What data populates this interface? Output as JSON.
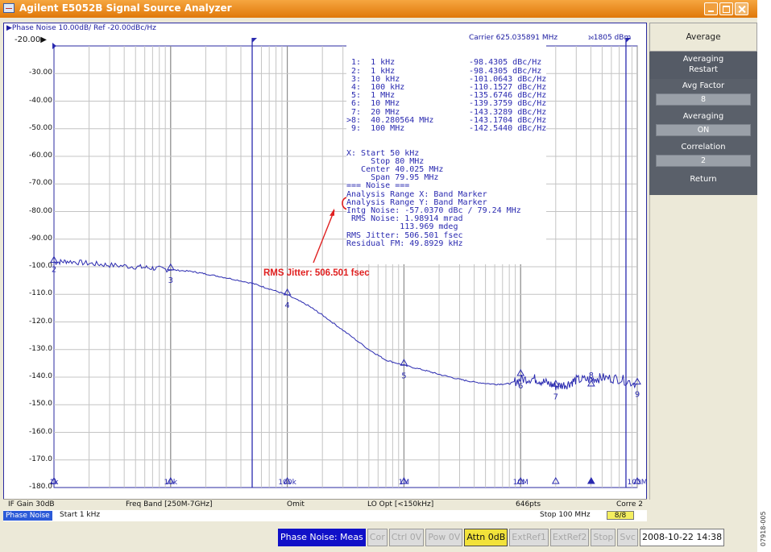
{
  "window": {
    "title": "Agilent E5052B Signal Source Analyzer",
    "accent_color": "#e0780a",
    "controls": [
      "minimize-icon",
      "maximize-icon",
      "close-icon"
    ]
  },
  "plot": {
    "header_left": "▶Phase Noise 10.00dB/ Ref -20.00dBc/Hz",
    "ref_label": "-20.00▶",
    "carrier": "Carrier 625.035891 MHz",
    "carrier_power": "⟕1805 dBm",
    "y_labels": [
      "-30.00",
      "-40.00",
      "-50.00",
      "-60.00",
      "-70.00",
      "-80.00",
      "-90.00",
      "-100.0",
      "-110.0",
      "-120.0",
      "-130.0",
      "-140.0",
      "-150.0",
      "-160.0",
      "-170.0",
      "-180.0"
    ],
    "x_labels": [
      "1k",
      "10k",
      "100k",
      "1M",
      "10M",
      "100M"
    ],
    "trace_color": "#2a2ab0",
    "markers": [
      {
        "id": "1",
        "freq": "1 kHz",
        "value": "-98.4305 dBc/Hz"
      },
      {
        "id": "2",
        "freq": "1 kHz",
        "value": "-98.4305 dBc/Hz"
      },
      {
        "id": "3",
        "freq": "10 kHz",
        "value": "-101.0643 dBc/Hz"
      },
      {
        "id": "4",
        "freq": "100 kHz",
        "value": "-110.1527 dBc/Hz"
      },
      {
        "id": "5",
        "freq": "1 MHz",
        "value": "-135.6746 dBc/Hz"
      },
      {
        "id": "6",
        "freq": "10 MHz",
        "value": "-139.3759 dBc/Hz"
      },
      {
        "id": "7",
        "freq": "20 MHz",
        "value": "-143.3289 dBc/Hz"
      },
      {
        "id": ">8",
        "freq": "40.280564 MHz",
        "value": "-143.1704 dBc/Hz"
      },
      {
        "id": "9",
        "freq": "100 MHz",
        "value": "-142.5440 dBc/Hz"
      }
    ],
    "info_lines": [
      "X: Start 50 kHz",
      "     Stop 80 MHz",
      "   Center 40.025 MHz",
      "     Span 79.95 MHz",
      "=== Noise ===",
      "Analysis Range X: Band Marker",
      "Analysis Range Y: Band Marker",
      "Intg Noise: -57.0370 dBc / 79.24 MHz",
      " RMS Noise: 1.98914 mrad",
      "           113.969 mdeg",
      "RMS Jitter: 506.501 fsec",
      "Residual FM: 49.8929 kHz"
    ],
    "annotation": "RMS Jitter: 506.501 fsec",
    "annotation_color": "#e02020"
  },
  "softkeys": {
    "menu": "Average",
    "restart": [
      "Averaging",
      "Restart"
    ],
    "avg_factor": {
      "label": "Avg Factor",
      "value": "8"
    },
    "averaging": {
      "label": "Averaging",
      "value": "ON"
    },
    "correlation": {
      "label": "Correlation",
      "value": "2"
    },
    "return": "Return"
  },
  "status_row1": {
    "if_gain": "IF Gain 30dB",
    "freq_band": "Freq Band [250M-7GHz]",
    "omit": "Omit",
    "lo_opt": "LO Opt [<150kHz]",
    "points": "646pts",
    "corre": "Corre 2"
  },
  "status_row2": {
    "mode": "Phase Noise",
    "start": "Start 1 kHz",
    "stop": "Stop 100 MHz",
    "count": "8/8"
  },
  "status_bar": {
    "meas": "Phase Noise: Meas",
    "cor": "Cor",
    "ctrl": "Ctrl 0V",
    "pow": "Pow 0V",
    "attn": "Attn 0dB",
    "extref1": "ExtRef1",
    "extref2": "ExtRef2",
    "stop": "Stop",
    "svc": "Svc",
    "clock": "2008-10-22 14:38"
  },
  "doc_id": "07918-005"
}
